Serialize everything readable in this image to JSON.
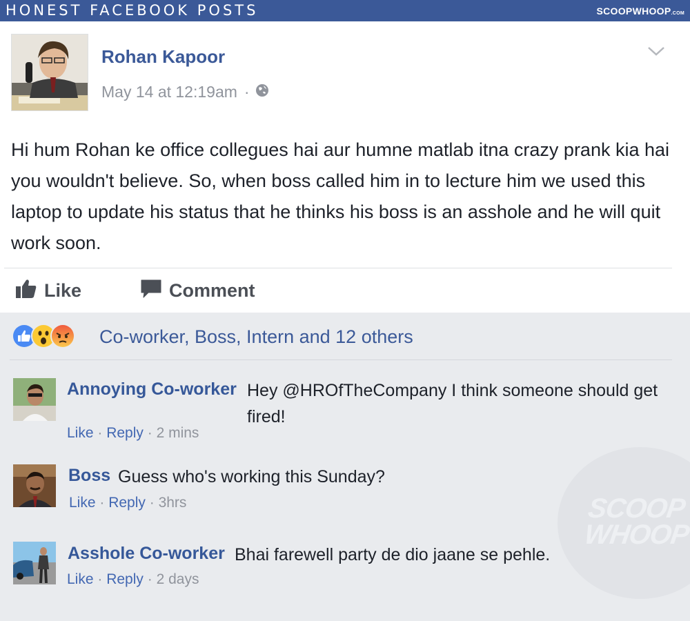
{
  "banner": {
    "title": "HONEST FACEBOOK POSTS",
    "logo": "SCOOPWHOOP",
    "logo_suffix": ".COM"
  },
  "post": {
    "author": "Rohan Kapoor",
    "timestamp": "May 14 at 12:19am",
    "separator": "·",
    "privacy_icon": "globe-icon",
    "menu_icon": "chevron-down-icon",
    "text": "Hi hum Rohan ke office collegues hai aur humne matlab itna crazy prank kia hai you wouldn't believe. So, when boss called him in to lecture him we used this laptop to update his status that he thinks his boss is an asshole and he will quit work soon.",
    "actions": {
      "like_label": "Like",
      "comment_label": "Comment"
    }
  },
  "reactions": {
    "icons": [
      "like-reaction-icon",
      "wow-reaction-icon",
      "angry-reaction-icon"
    ],
    "summary": "Co-worker, Boss, Intern and 12 others"
  },
  "comments": [
    {
      "author": "Annoying Co-worker",
      "text": "Hey @HROfTheCompany I think someone should get fired!",
      "like": "Like",
      "reply": "Reply",
      "time": "2 mins"
    },
    {
      "author": "Boss",
      "text": "Guess who's working this Sunday?",
      "like": "Like",
      "reply": "Reply",
      "time": "3hrs"
    },
    {
      "author": "Asshole Co-worker",
      "text": "Bhai farewell party de dio jaane se pehle.",
      "like": "Like",
      "reply": "Reply",
      "time": "2 days"
    }
  ],
  "watermark": {
    "line1": "SCOOP",
    "line2": "WHOOP"
  },
  "colors": {
    "facebook_blue": "#3b5998",
    "link_blue": "#365899",
    "comments_background": "#e9ebee",
    "meta_gray": "#90949c"
  }
}
